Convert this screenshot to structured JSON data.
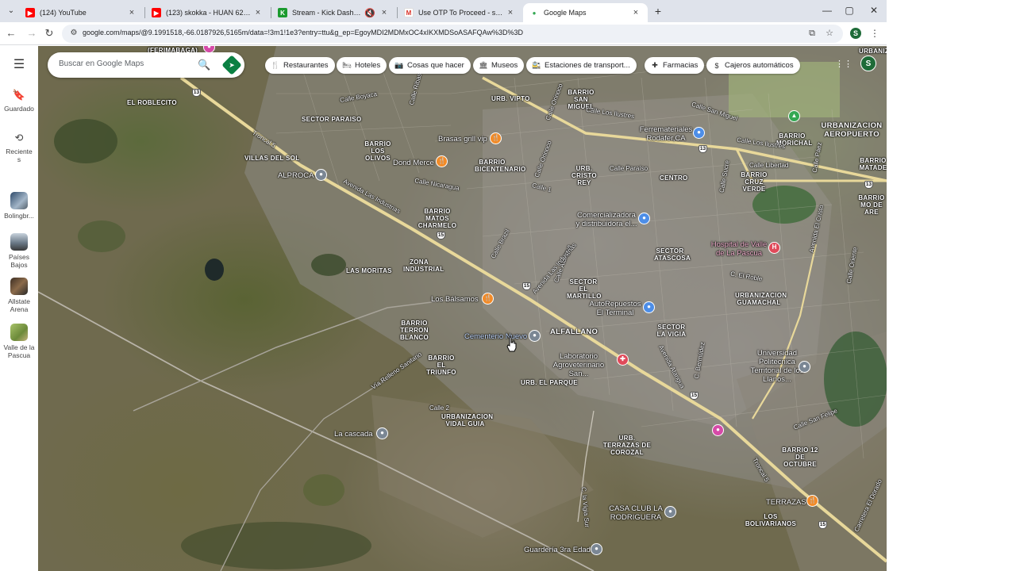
{
  "browser": {
    "tabs": [
      {
        "title": "(124) YouTube",
        "favicon": "youtube-icon",
        "active": false
      },
      {
        "title": "(123) skokka - HUAN 62 - (Vídeo...",
        "favicon": "youtube-icon",
        "active": false
      },
      {
        "title": "Stream - Kick Dashboard",
        "favicon": "kick-icon",
        "active": false
      },
      {
        "title": "Use OTP To Proceed - sandexve...",
        "favicon": "gmail-icon",
        "active": false
      },
      {
        "title": "Google Maps",
        "favicon": "google-maps-icon",
        "active": true
      }
    ],
    "url": "google.com/maps/@9.1991518,-66.0187926,5165m/data=!3m1!1e3?entry=ttu&g_ep=EgoyMDI2MDMxOC4xIKXMDSoASAFQAw%3D%3D",
    "profile_initial": "S"
  },
  "rail": {
    "items": [
      {
        "label": "Guardado",
        "icon": "bookmark-icon"
      },
      {
        "label": "Reciente s",
        "icon": "history-icon"
      },
      {
        "label": "Bolingbr...",
        "icon": "place-thumbnail"
      },
      {
        "label": "Países Bajos",
        "icon": "place-thumbnail"
      },
      {
        "label": "Allstate Arena",
        "icon": "place-thumbnail"
      },
      {
        "label": "Valle de la Pascua",
        "icon": "place-thumbnail"
      }
    ]
  },
  "search": {
    "placeholder": "Buscar en Google Maps"
  },
  "chips": [
    {
      "label": "Restaurantes",
      "icon": "fork-knife-icon"
    },
    {
      "label": "Hoteles",
      "icon": "bed-icon"
    },
    {
      "label": "Cosas que hacer",
      "icon": "camera-icon"
    },
    {
      "label": "Museos",
      "icon": "museum-icon"
    },
    {
      "label": "Estaciones de transport...",
      "icon": "transit-icon"
    },
    {
      "label": "Farmacias",
      "icon": "pharmacy-icon"
    },
    {
      "label": "Cajeros automáticos",
      "icon": "atm-icon"
    }
  ],
  "account_initial": "S",
  "map": {
    "areas": [
      "(FERIMABAGA)",
      "EL ROBLECITO",
      "SECTOR PARAISO",
      "URB. VIPTO",
      "BARRIO LOS OLIVOS",
      "VILLAS DEL SOL",
      "BARRIO SAN MIGUEL",
      "BARRIO BICENTENARIO",
      "URB. CRISTO REY",
      "CENTRO",
      "BARRIO CRUZ VERDE",
      "URBANIZACION AEROPUERTO",
      "BARRIO MORICHAL",
      "BARRIO MATOS CHARMELO",
      "ZONA INDUSTRIAL",
      "LAS MORITAS",
      "SECTOR ATASCOSA",
      "SECTOR EL MARTILLO",
      "URBANIZACION GUAMACHAL",
      "BARRIO TERRON BLANCO",
      "BARRIO EL TRIUNFO",
      "ALFALLANO",
      "SECTOR LA VIGIA",
      "URB. EL PARQUE",
      "URBANIZACION VIDAL GUIA",
      "URB. TERRAZAS DE COROZAL",
      "BARRIO 12 DE OCTUBRE",
      "LOS BOLIVARIANOS",
      "BARRIO MATADE",
      "BARRIO MO DE ARE",
      "URBANIZACION"
    ],
    "places": [
      "Brasas grill vip",
      "Dond Merce",
      "ALPROCA",
      "Ferremateriales Rodafer,CA",
      "Comercializadora y distribuidora el...",
      "Hospital de Valle de La Pascua",
      "Los Bálsamos",
      "AutoRepuestos El Terminal",
      "Cementerio Nuevo",
      "Laboratorio Agroveterinario San...",
      "Universidad Politécnica Territorial de los Llanos...",
      "La cascada",
      "CASA CLUB LA RODRIGUERA",
      "TERRAZAS",
      "Guardería 3ra Edad"
    ],
    "roads": [
      "Troncal 5",
      "Avenida Las Industrias",
      "Calle Boyaca",
      "Calle Ribas",
      "Calle Orinoco",
      "Calle Los Ilustres",
      "Calle San Miguel",
      "Calle Paraíso",
      "Calle Sucre",
      "Calle Libertad",
      "Calle Los Ilustres",
      "Calle Páez",
      "Calle Orinoco",
      "Calle Nicaragua",
      "Calle 1",
      "Calle Brazil",
      "Calle Atarigua",
      "Avenida Las Industrias",
      "Avenida El Cristo",
      "C. El Roble",
      "Avenida Atarigua",
      "C. Bermúdez",
      "Vía Relleno Sanitario",
      "Calle 2",
      "C. la Vigia Sur",
      "Calle San Felipe",
      "Calle Oriente",
      "Carretera El Dorado",
      "Troncal 5"
    ],
    "route_shields": [
      "13",
      "15",
      "15",
      "15",
      "15",
      "13",
      "13"
    ]
  }
}
